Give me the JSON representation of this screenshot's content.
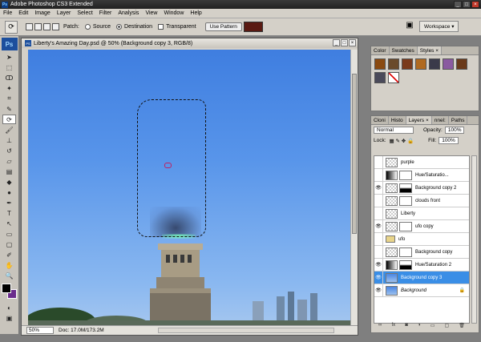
{
  "titlebar": {
    "app_icon": "Ps",
    "title": "Adobe Photoshop CS3 Extended"
  },
  "menu": [
    "File",
    "Edit",
    "Image",
    "Layer",
    "Select",
    "Filter",
    "Analysis",
    "View",
    "Window",
    "Help"
  ],
  "options": {
    "tool_icon": "patch-tool-icon",
    "patch_label": "Patch:",
    "source_label": "Source",
    "destination_label": "Destination",
    "transparent_label": "Transparent",
    "use_pattern_label": "Use Pattern",
    "pattern_color": "#5a1a12",
    "workspace_label": "Workspace ▾"
  },
  "toolbox": {
    "logo": "Ps",
    "fg_color": "#000000",
    "bg_color": "#6a2c8c"
  },
  "document": {
    "title": "Liberty's Amazing Day.psd @ 50% (Background copy 3, RGB/8)",
    "zoom": "50%",
    "doc_info": "Doc: 17.0M/173.2M"
  },
  "styles_panel": {
    "tabs": [
      "Color",
      "Swatches",
      "Styles ×"
    ],
    "swatches": [
      "#8a4a10",
      "#6a4a2a",
      "#7a3a1a",
      "#b06a20",
      "#3a3a4a",
      "#8a5aa0",
      "#6a3a1a",
      "#4a4a5a",
      "#ffffff"
    ]
  },
  "layers_panel": {
    "tabs": [
      "Cloni",
      "Histo",
      "Layers ×",
      "nnel:",
      "Paths"
    ],
    "blend_mode": "Normal",
    "opacity_label": "Opacity:",
    "opacity": "100%",
    "lock_label": "Lock:",
    "fill_label": "Fill:",
    "fill": "100%",
    "layers": [
      {
        "name": "purple",
        "visible": false,
        "thumb": "checker",
        "mask": false
      },
      {
        "name": "Hue/Saturatio...",
        "visible": false,
        "thumb": "adj",
        "mask": true
      },
      {
        "name": "Background copy 2",
        "visible": true,
        "thumb": "checker",
        "mask": true
      },
      {
        "name": "clouds front",
        "visible": false,
        "thumb": "checker",
        "mask": true
      },
      {
        "name": "Liberty",
        "visible": false,
        "thumb": "checker",
        "mask": false
      },
      {
        "name": "ufo copy",
        "visible": true,
        "thumb": "checker",
        "mask": true
      },
      {
        "name": "ufo",
        "visible": false,
        "thumb": "folder",
        "mask": false
      },
      {
        "name": "Background copy",
        "visible": false,
        "thumb": "checker",
        "mask": true
      },
      {
        "name": "Hue/Saturation 2",
        "visible": true,
        "thumb": "adj",
        "mask": true
      },
      {
        "name": "Background copy 3",
        "visible": true,
        "thumb": "sky",
        "mask": false,
        "selected": true
      },
      {
        "name": "Background",
        "visible": true,
        "thumb": "sky",
        "mask": false,
        "locked": true
      }
    ],
    "footer_icons": [
      "link-icon",
      "fx-icon",
      "mask-icon",
      "adjust-icon",
      "folder-icon",
      "new-layer-icon",
      "trash-icon"
    ]
  }
}
